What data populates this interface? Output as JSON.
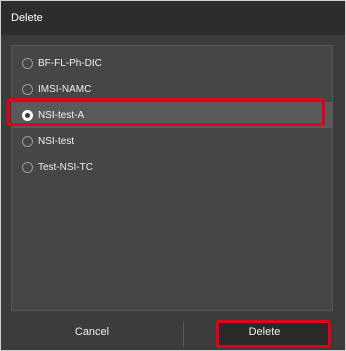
{
  "dialog": {
    "title": "Delete"
  },
  "list": {
    "items": [
      {
        "label": "BF-FL-Ph-DIC",
        "selected": false
      },
      {
        "label": "IMSI-NAMC",
        "selected": false
      },
      {
        "label": "NSI-test-A",
        "selected": true
      },
      {
        "label": "NSI-test",
        "selected": false
      },
      {
        "label": "Test-NSI-TC",
        "selected": false
      }
    ]
  },
  "footer": {
    "cancel_label": "Cancel",
    "delete_label": "Delete"
  },
  "colors": {
    "highlight": "#e0001a",
    "background": "#3c3c3c",
    "header": "#2d2d2d"
  }
}
